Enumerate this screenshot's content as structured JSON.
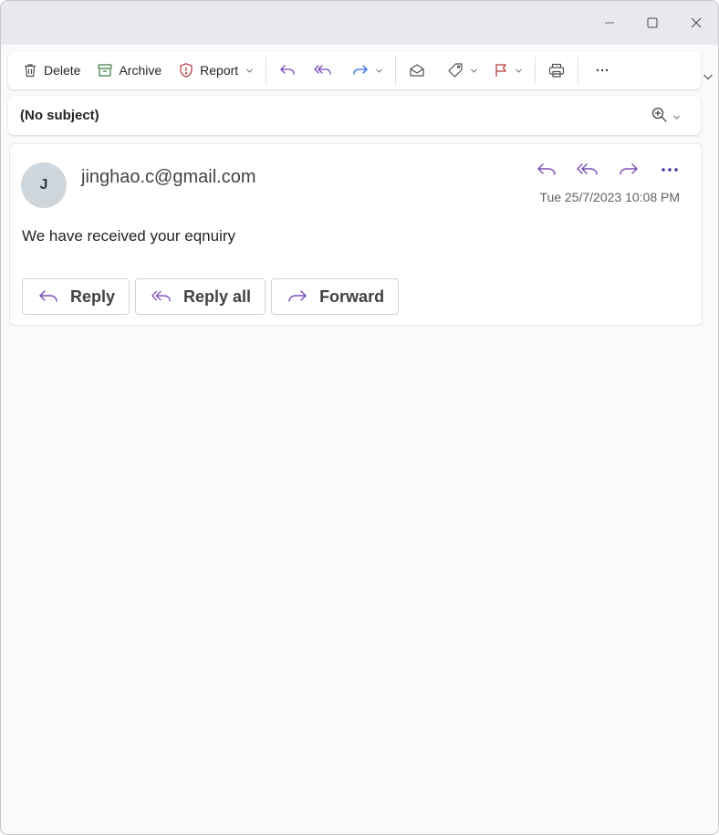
{
  "window": {
    "controls": [
      {
        "name": "minimize",
        "icon": "minimize-icon"
      },
      {
        "name": "maximize",
        "icon": "maximize-icon"
      },
      {
        "name": "close",
        "icon": "close-icon"
      }
    ]
  },
  "toolbar": {
    "delete_label": "Delete",
    "archive_label": "Archive",
    "report_label": "Report",
    "icons": [
      "trash-icon",
      "archive-icon",
      "shield-alert-icon",
      "reply-icon",
      "reply-all-icon",
      "forward-icon",
      "envelope-open-icon",
      "tag-icon",
      "flag-icon",
      "printer-icon",
      "more-icon"
    ]
  },
  "subject": {
    "text": "(No subject)"
  },
  "message": {
    "avatar_initial": "J",
    "sender": "jinghao.c@gmail.com",
    "timestamp": "Tue 25/7/2023 10:08 PM",
    "body": "We have received your eqnuiry"
  },
  "quick_actions": {
    "reply_label": "Reply",
    "reply_all_label": "Reply all",
    "forward_label": "Forward"
  },
  "colors": {
    "accent_purple": "#7a4bb6",
    "forward_blue": "#2f6fd6",
    "archive_green": "#3a7d44",
    "report_red": "#b4373a",
    "flag_red": "#b4373a",
    "titlebar": "#e7e9ee",
    "canvas": "#fafafa"
  }
}
